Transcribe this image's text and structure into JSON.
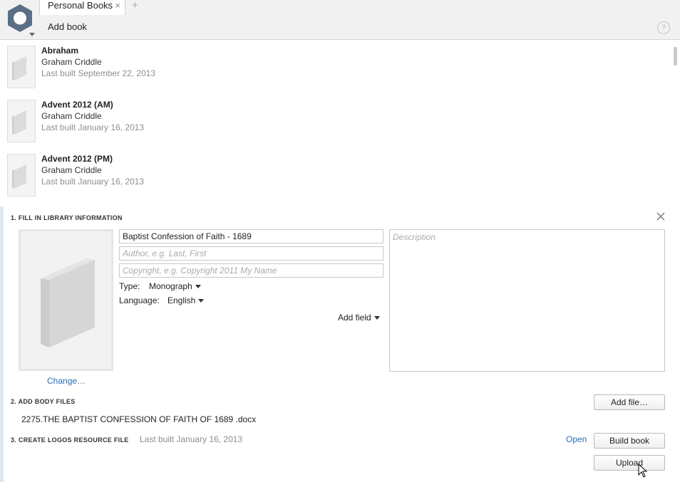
{
  "header": {
    "tab_label": "Personal Books",
    "tab_close": "×",
    "tab_add": "+",
    "add_book_label": "Add book",
    "help_glyph": "?"
  },
  "books": [
    {
      "title": "Abraham",
      "author": "Graham Criddle",
      "built": "Last built September 22, 2013"
    },
    {
      "title": "Advent 2012 (AM)",
      "author": "Graham Criddle",
      "built": "Last built January 16, 2013"
    },
    {
      "title": "Advent 2012 (PM)",
      "author": "Graham Criddle",
      "built": "Last built January 16, 2013"
    }
  ],
  "panel": {
    "section1_title": "1. FILL IN LIBRARY INFORMATION",
    "change_label": "Change…",
    "title_value": "Baptist Confession of Faith - 1689",
    "author_placeholder": "Author, e.g. Last, First",
    "copyright_placeholder": "Copyright, e.g. Copyright 2011 My Name",
    "type_label": "Type:",
    "type_value": "Monograph",
    "language_label": "Language:",
    "language_value": "English",
    "add_field_label": "Add field",
    "description_placeholder": "Description",
    "section2_title": "2. ADD BODY FILES",
    "add_file_label": "Add file…",
    "file_name": "2275.THE BAPTIST CONFESSION OF FAITH OF 1689 .docx",
    "section3_title": "3. CREATE LOGOS RESOURCE FILE",
    "last_built": "Last built January 16, 2013",
    "open_label": "Open",
    "build_label": "Build book",
    "upload_label": "Upload"
  },
  "colors": {
    "link": "#2a6db5",
    "muted": "#8e8e8e",
    "header_bg": "#f1f1f1",
    "panel_accent": "#dfe8f1"
  },
  "icons": [
    "app-logo-icon",
    "book-cover-icon",
    "help-icon",
    "close-icon",
    "chevron-down-icon",
    "mouse-cursor-icon"
  ]
}
